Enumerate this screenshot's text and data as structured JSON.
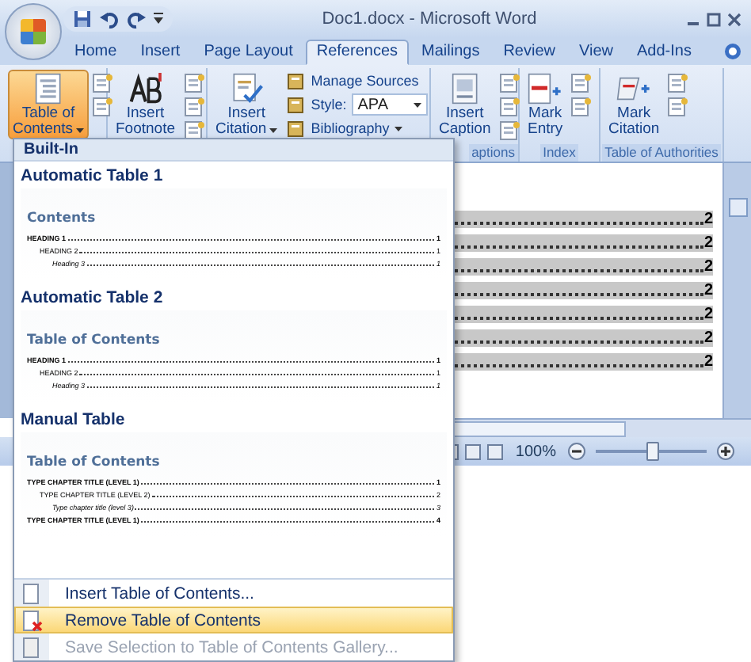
{
  "window": {
    "title": "Doc1.docx - Microsoft Word"
  },
  "tabs": [
    {
      "label": "Home",
      "selected": false
    },
    {
      "label": "Insert",
      "selected": false
    },
    {
      "label": "Page Layout",
      "selected": false
    },
    {
      "label": "References",
      "selected": true
    },
    {
      "label": "Mailings",
      "selected": false
    },
    {
      "label": "Review",
      "selected": false
    },
    {
      "label": "View",
      "selected": false
    },
    {
      "label": "Add-Ins",
      "selected": false
    }
  ],
  "ribbon": {
    "groups": [
      {
        "kind": "toc",
        "large": {
          "lines": [
            "Table of",
            "Contents"
          ],
          "dropdown": true,
          "pressed": true
        }
      },
      {
        "kind": "footnotes",
        "large": {
          "lines": [
            "Insert",
            "Footnote"
          ],
          "dropdown": false,
          "pressed": false
        }
      },
      {
        "kind": "citations",
        "large": {
          "lines": [
            "Insert",
            "Citation"
          ],
          "dropdown": true,
          "pressed": false
        },
        "small": [
          {
            "label": "Manage Sources"
          },
          {
            "label": "Style:",
            "value": "APA"
          },
          {
            "label": "Bibliography",
            "dropdown": true
          }
        ]
      },
      {
        "kind": "captions",
        "label": "aptions",
        "large": {
          "lines": [
            "Insert",
            "Caption"
          ],
          "dropdown": false,
          "pressed": false
        }
      },
      {
        "kind": "index",
        "label": "Index",
        "large": {
          "lines": [
            "Mark",
            "Entry"
          ],
          "dropdown": false,
          "pressed": false
        }
      },
      {
        "kind": "authorities",
        "label": "Table of Authorities",
        "large": {
          "lines": [
            "Mark",
            "Citation"
          ],
          "dropdown": false,
          "pressed": false
        }
      }
    ]
  },
  "document": {
    "rows": [
      {
        "page": "2"
      },
      {
        "page": "2"
      },
      {
        "page": "2"
      },
      {
        "page": "2"
      },
      {
        "page": "2"
      },
      {
        "page": "2"
      },
      {
        "page": "2"
      }
    ]
  },
  "status_bar": {
    "zoom": "100%",
    "zoom_slider": {
      "level": 0.5
    }
  },
  "toc_menu": {
    "header": "Built-In",
    "gallery": [
      {
        "label": "Automatic Table 1",
        "title": "Contents",
        "entries": [
          {
            "text": "HEADING 1",
            "page": "1",
            "kind": "level1"
          },
          {
            "text": "HEADING 2",
            "page": "1",
            "kind": "level2"
          },
          {
            "text": "Heading 3",
            "page": "1",
            "kind": "level3"
          }
        ]
      },
      {
        "label": "Automatic Table 2",
        "title": "Table of Contents",
        "entries": [
          {
            "text": "HEADING 1",
            "page": "1",
            "kind": "level1"
          },
          {
            "text": "HEADING 2",
            "page": "1",
            "kind": "level2"
          },
          {
            "text": "Heading 3",
            "page": "1",
            "kind": "level3"
          }
        ]
      },
      {
        "label": "Manual Table",
        "title": "Table of Contents",
        "entries": [
          {
            "text": "TYPE CHAPTER TITLE (LEVEL 1)",
            "page": "1",
            "kind": "level1"
          },
          {
            "text": "TYPE CHAPTER TITLE (LEVEL 2)",
            "page": "2",
            "kind": "level2"
          },
          {
            "text": "Type chapter title (level 3)",
            "page": "3",
            "kind": "level3"
          },
          {
            "text": "TYPE CHAPTER TITLE (LEVEL 1)",
            "page": "4",
            "kind": "level1"
          }
        ]
      }
    ],
    "commands": [
      {
        "label": "Insert Table of Contents...",
        "selected": false,
        "disabled": false
      },
      {
        "label": "Remove Table of Contents",
        "selected": true,
        "disabled": false
      },
      {
        "label": "Save Selection to Table of Contents Gallery...",
        "selected": false,
        "disabled": true
      }
    ]
  }
}
